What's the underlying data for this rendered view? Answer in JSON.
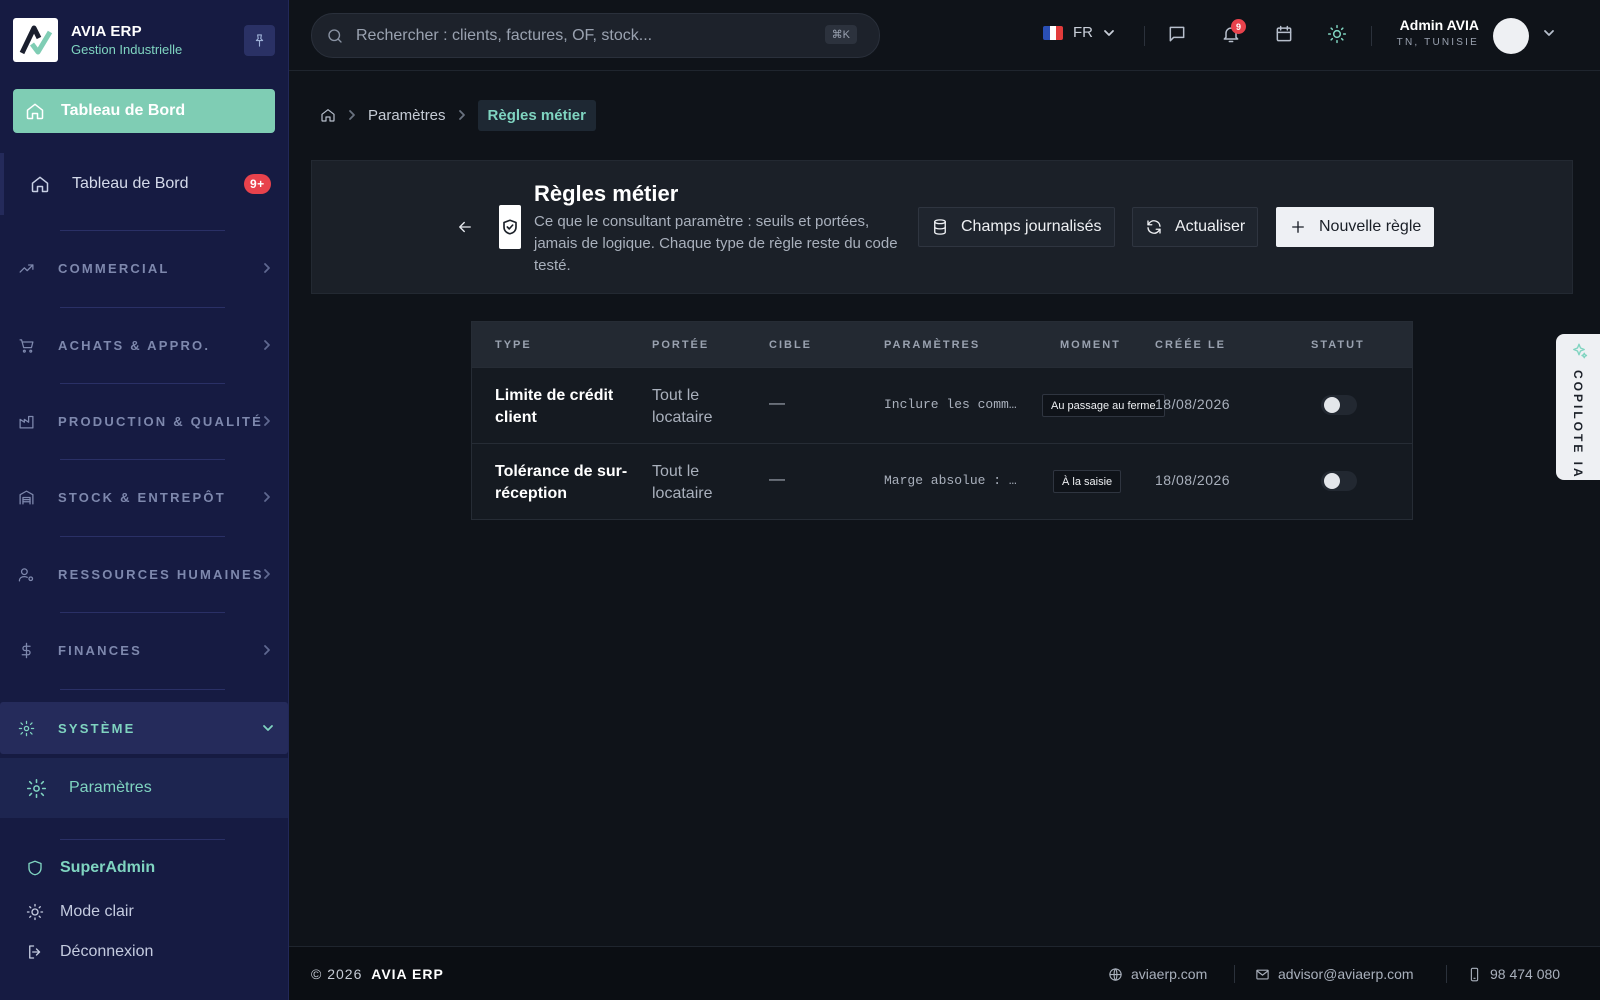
{
  "brand": {
    "title": "AVIA ERP",
    "subtitle": "Gestion Industrielle"
  },
  "sidebar": {
    "dashboard_main": "Tableau de Bord",
    "dashboard_item": {
      "label": "Tableau de Bord",
      "badge": "9+"
    },
    "sections": [
      {
        "label": "COMMERCIAL",
        "icon": "trending-up-icon"
      },
      {
        "label": "ACHATS & APPRO.",
        "icon": "cart-icon"
      },
      {
        "label": "PRODUCTION & QUALITÉ",
        "icon": "factory-icon"
      },
      {
        "label": "STOCK & ENTREPÔT",
        "icon": "warehouse-icon"
      },
      {
        "label": "RESSOURCES HUMAINES",
        "icon": "user-settings-icon"
      },
      {
        "label": "FINANCES",
        "icon": "dollar-icon"
      },
      {
        "label": "SYSTÈME",
        "icon": "gear-icon"
      }
    ],
    "system_sub": "Paramètres",
    "footer": {
      "role": "SuperAdmin",
      "theme": "Mode clair",
      "logout": "Déconnexion"
    }
  },
  "topbar": {
    "search_placeholder": "Rechercher : clients, factures, OF, stock...",
    "search_shortcut": "⌘K",
    "language": "FR",
    "notifications_count": "9",
    "user": {
      "name": "Admin AVIA",
      "location": "TN, TUNISIE"
    }
  },
  "breadcrumb": {
    "parent": "Paramètres",
    "current": "Règles métier"
  },
  "header": {
    "title": "Règles métier",
    "description": "Ce que le consultant paramètre : seuils et portées, jamais de logique. Chaque type de règle reste du code testé.",
    "buttons": {
      "logged_fields": "Champs journalisés",
      "refresh": "Actualiser",
      "new_rule": "Nouvelle règle"
    }
  },
  "table": {
    "columns": [
      "TYPE",
      "PORTÉE",
      "CIBLE",
      "PARAMÈTRES",
      "MOMENT",
      "CRÉÉE LE",
      "STATUT"
    ],
    "rows": [
      {
        "type": "Limite de crédit client",
        "scope": "Tout le locataire",
        "target": "—",
        "params": "Inclure les comm…",
        "moment": "Au passage au ferme",
        "created": "18/08/2026",
        "active": false
      },
      {
        "type": "Tolérance de sur-réception",
        "scope": "Tout le locataire",
        "target": "—",
        "params": "Marge absolue : …",
        "moment": "À la saisie",
        "created": "18/08/2026",
        "active": false
      }
    ]
  },
  "copilot": {
    "label": "COPILOTE IA"
  },
  "footer": {
    "copyright_prefix": "© 2026",
    "copyright_brand": "AVIA ERP",
    "website": "aviaerp.com",
    "email": "advisor@aviaerp.com",
    "phone": "98 474 080"
  },
  "colors": {
    "accent": "#7fcdb4",
    "sidebar_bg": "#161b42",
    "page_bg": "#0f1319",
    "badge": "#e8424c"
  }
}
